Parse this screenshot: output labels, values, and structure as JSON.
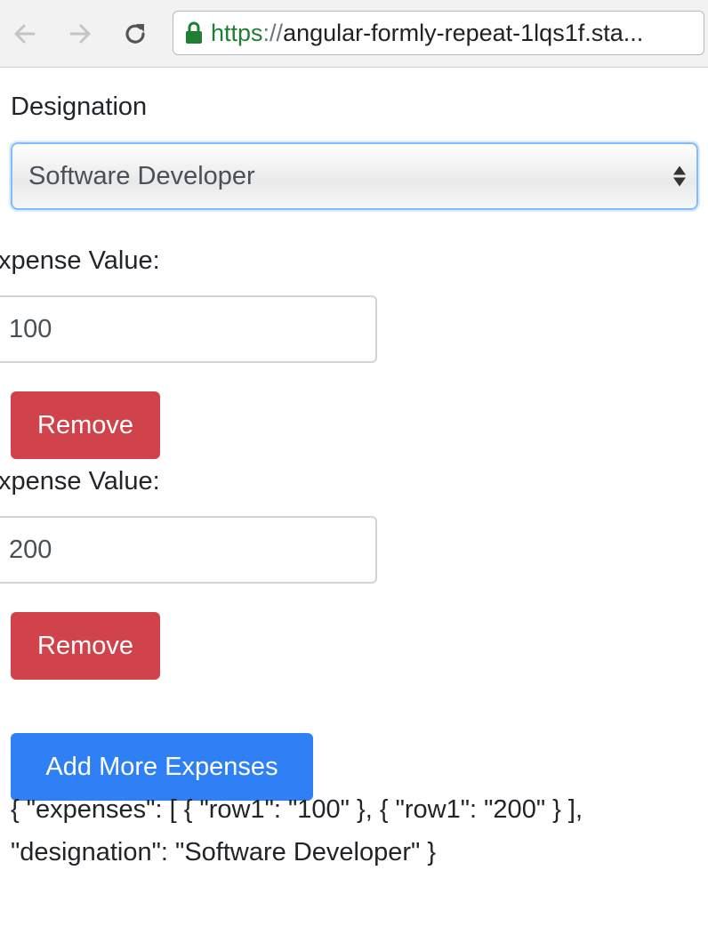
{
  "browser": {
    "url_scheme": "https",
    "url_separator": "://",
    "url_host": "angular-formly-repeat-1lqs1f.sta..."
  },
  "form": {
    "designation_label": "Designation",
    "designation_value": "Software Developer",
    "expenses": [
      {
        "label": "xpense Value:",
        "value": "100",
        "remove_label": "Remove"
      },
      {
        "label": "xpense Value:",
        "value": "200",
        "remove_label": "Remove"
      }
    ],
    "add_button_label": "Add More Expenses"
  },
  "model_output": {
    "line1": "{ \"expenses\": [ { \"row1\": \"100\" }, { \"row1\": \"200\" } ],",
    "line2": "\"designation\": \"Software Developer\" }"
  },
  "colors": {
    "danger": "#d1434b",
    "primary": "#2f80f5",
    "focus_border": "#80bdff",
    "secure_green": "#1e7e34"
  },
  "icons": [
    "back-arrow-icon",
    "forward-arrow-icon",
    "reload-icon",
    "lock-icon",
    "select-arrows-icon"
  ]
}
